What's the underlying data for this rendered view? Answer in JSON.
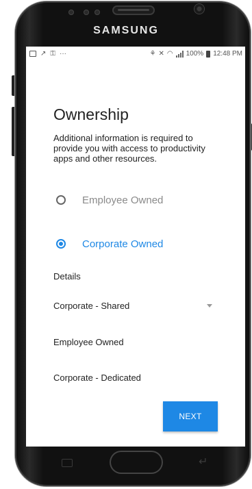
{
  "device": {
    "brand": "SAMSUNG"
  },
  "status_bar": {
    "left_icons": [
      "image-icon",
      "missed-call-icon",
      "key-icon",
      "more-dots-icon"
    ],
    "left_dots": "···",
    "right_icons": [
      "nfc-icon",
      "mute-icon",
      "wifi-icon",
      "signal-icon"
    ],
    "battery_percent": "100%",
    "time": "12:48 PM"
  },
  "page": {
    "title": "Ownership",
    "description": "Additional information is required to provide you with access to productivity apps and other resources.",
    "radio_options": [
      {
        "label": "Employee Owned",
        "checked": false
      },
      {
        "label": "Corporate Owned",
        "checked": true
      }
    ],
    "details_label": "Details",
    "dropdown": {
      "selected": "Corporate - Shared"
    },
    "options": [
      "Employee Owned",
      "Corporate - Dedicated"
    ],
    "next_label": "NEXT"
  },
  "colors": {
    "accent": "#1e88e5",
    "text": "#222222",
    "muted": "#8a8a8a"
  }
}
